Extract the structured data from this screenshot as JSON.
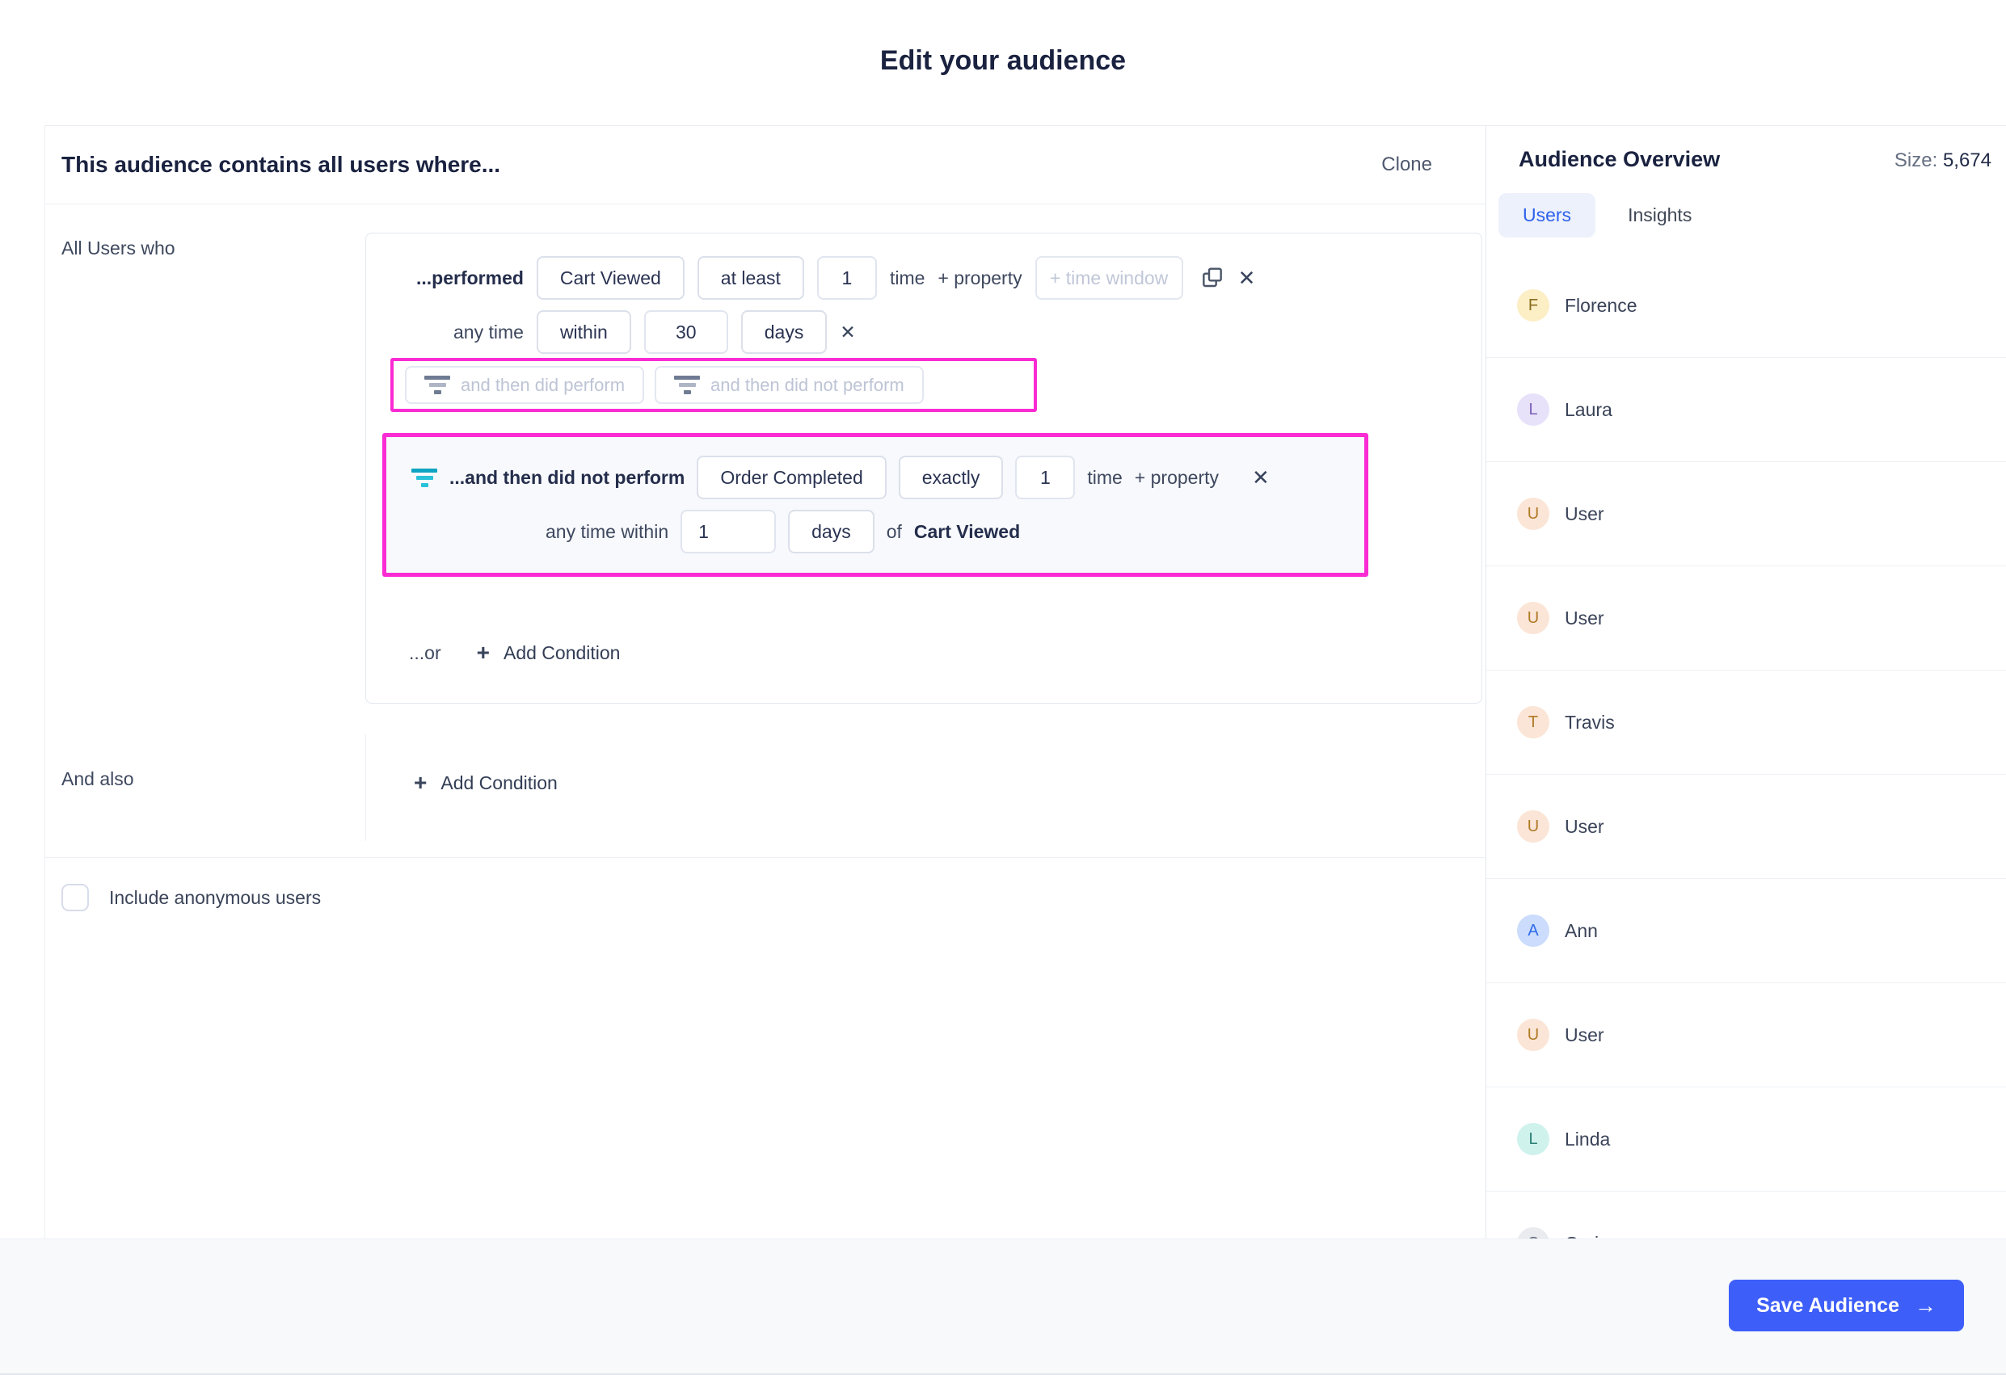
{
  "page": {
    "title": "Edit your audience"
  },
  "icons": {
    "plus": "+",
    "close": "✕",
    "arrow": "→"
  },
  "builder": {
    "header": "This audience contains all users where...",
    "clone_label": "Clone",
    "section1_label": "All Users who",
    "row1": {
      "prefix": "...performed",
      "event": "Cart Viewed",
      "operator": "at least",
      "count": "1",
      "suffix": "time",
      "add_property": "+ property",
      "time_window_placeholder": "+ time window"
    },
    "row2": {
      "prefix": "any time",
      "operator": "within",
      "value": "30",
      "unit": "days"
    },
    "suggestions": {
      "perform": "and then did perform",
      "not_perform": "and then did not perform"
    },
    "subcondition": {
      "prefix": "...and then did not perform",
      "event": "Order Completed",
      "operator": "exactly",
      "count": "1",
      "suffix": "time",
      "add_property": "+ property",
      "window_prefix": "any time within",
      "window_value": "1",
      "window_unit": "days",
      "window_of": "of",
      "window_event": "Cart Viewed"
    },
    "or_label": "...or",
    "add_condition_label": "Add Condition",
    "section2_label": "And also",
    "anonymous_label": "Include anonymous users"
  },
  "sidebar": {
    "title": "Audience Overview",
    "size_label": "Size:",
    "size_value": "5,674",
    "tabs": [
      {
        "label": "Users",
        "active": true
      },
      {
        "label": "Insights",
        "active": false
      }
    ],
    "users": [
      {
        "name": "Florence",
        "initial": "F",
        "bg": "#FCEEC5",
        "fg": "#8A6D1D"
      },
      {
        "name": "Laura",
        "initial": "L",
        "bg": "#E7E1F9",
        "fg": "#7A5FB8"
      },
      {
        "name": "User",
        "initial": "U",
        "bg": "#FBE5D6",
        "fg": "#B07A28"
      },
      {
        "name": "User",
        "initial": "U",
        "bg": "#FBE5D6",
        "fg": "#B07A28"
      },
      {
        "name": "Travis",
        "initial": "T",
        "bg": "#FBE5D6",
        "fg": "#B07A28"
      },
      {
        "name": "User",
        "initial": "U",
        "bg": "#FBE5D6",
        "fg": "#B07A28"
      },
      {
        "name": "Ann",
        "initial": "A",
        "bg": "#CBDCFC",
        "fg": "#2F6BEB"
      },
      {
        "name": "User",
        "initial": "U",
        "bg": "#FBE5D6",
        "fg": "#B07A28"
      },
      {
        "name": "Linda",
        "initial": "L",
        "bg": "#CFF2ED",
        "fg": "#2A7F74"
      },
      {
        "name": "Craig",
        "initial": "C",
        "bg": "#E9EBEF",
        "fg": "#5A6478"
      }
    ]
  },
  "footer": {
    "save_label": "Save Audience"
  },
  "colors": {
    "accent_magenta": "#FA2BD3",
    "accent_teal": "#16B0CC",
    "primary_blue": "#3D5EF8"
  }
}
